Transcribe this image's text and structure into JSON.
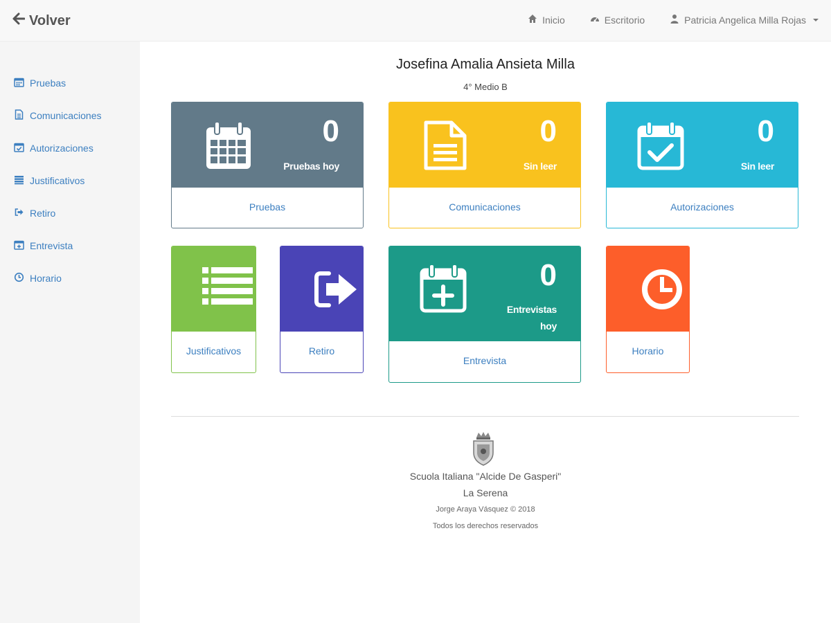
{
  "header": {
    "back_label": "Volver",
    "nav": [
      {
        "label": "Inicio",
        "icon": "home-icon"
      },
      {
        "label": "Escritorio",
        "icon": "dashboard-icon"
      },
      {
        "label": "Patricia Angelica Milla Rojas",
        "icon": "user-icon"
      }
    ]
  },
  "sidebar": {
    "items": [
      {
        "label": "Pruebas",
        "icon": "calendar-icon"
      },
      {
        "label": "Comunicaciones",
        "icon": "document-icon"
      },
      {
        "label": "Autorizaciones",
        "icon": "calendar-check-icon"
      },
      {
        "label": "Justificativos",
        "icon": "list-icon"
      },
      {
        "label": "Retiro",
        "icon": "sign-out-icon"
      },
      {
        "label": "Entrevista",
        "icon": "calendar-plus-icon"
      },
      {
        "label": "Horario",
        "icon": "clock-icon"
      }
    ]
  },
  "student": {
    "name": "Josefina Amalia Ansieta Milla",
    "course": "4° Medio B"
  },
  "cards": {
    "pruebas": {
      "count": "0",
      "sub": "Pruebas hoy",
      "label": "Pruebas",
      "color": "#627a89"
    },
    "comunicaciones": {
      "count": "0",
      "sub": "Sin leer",
      "label": "Comunicaciones",
      "color": "#f9c21e"
    },
    "autorizaciones": {
      "count": "0",
      "sub": "Sin leer",
      "label": "Autorizaciones",
      "color": "#27b8d6"
    },
    "justificativos": {
      "label": "Justificativos",
      "color": "#80c24a"
    },
    "retiro": {
      "label": "Retiro",
      "color": "#4a44b6"
    },
    "entrevista": {
      "count": "0",
      "sub_line1": "Entrevistas",
      "sub_line2": "hoy",
      "label": "Entrevista",
      "color": "#1c9a88"
    },
    "horario": {
      "label": "Horario",
      "color": "#fd5e2a"
    }
  },
  "footer": {
    "school": "Scuola Italiana \"Alcide De Gasperi\"",
    "city": "La Serena",
    "author": "Jorge Araya Vásquez © 2018",
    "rights": "Todos los derechos reservados"
  }
}
